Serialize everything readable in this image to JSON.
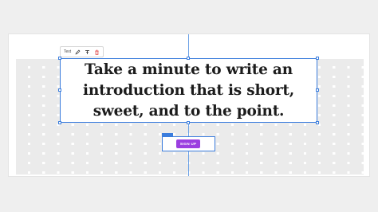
{
  "toolbar": {
    "text_label": "Text",
    "icons": [
      "pencil-icon",
      "text-format-icon",
      "delete-icon"
    ]
  },
  "headline": {
    "text": "Take a minute to write an introduction that is short, sweet, and to the point."
  },
  "button": {
    "label": "SIGN UP"
  },
  "colors": {
    "selection": "#3b7ddd",
    "button_bg": "#9b3fe0",
    "delete_icon": "#e04646",
    "grid_cell": "#ebebeb"
  }
}
